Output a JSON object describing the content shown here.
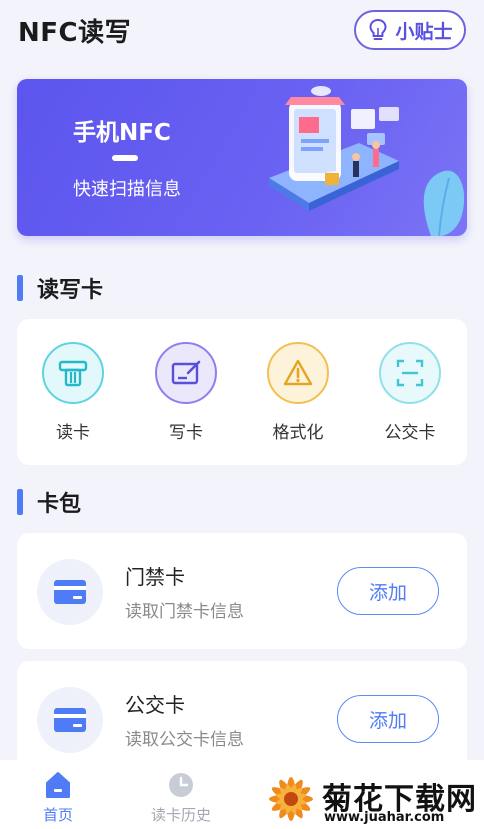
{
  "header": {
    "title": "NFC读写",
    "tips_label": "小贴士"
  },
  "banner": {
    "title": "手机NFC",
    "subtitle": "快速扫描信息"
  },
  "read_write": {
    "section_title": "读写卡",
    "items": [
      {
        "label": "读卡",
        "icon": "card-reader-icon",
        "color": "#3fc6d6"
      },
      {
        "label": "写卡",
        "icon": "edit-card-icon",
        "color": "#7567e8"
      },
      {
        "label": "格式化",
        "icon": "warning-icon",
        "color": "#f0b33a"
      },
      {
        "label": "公交卡",
        "icon": "scan-icon",
        "color": "#3fc6d6"
      }
    ]
  },
  "wallet": {
    "section_title": "卡包",
    "cards": [
      {
        "name": "门禁卡",
        "description": "读取门禁卡信息",
        "button": "添加"
      },
      {
        "name": "公交卡",
        "description": "读取公交卡信息",
        "button": "添加"
      }
    ]
  },
  "bottom_nav": {
    "items": [
      {
        "label": "首页",
        "icon": "home-icon",
        "active": true
      },
      {
        "label": "读卡历史",
        "icon": "clock-icon",
        "active": false
      }
    ]
  },
  "watermark": {
    "title": "菊花下载网",
    "url": "www.juahar.com"
  },
  "colors": {
    "accent": "#5c55ee",
    "blue": "#4f7cf6",
    "background": "#f3f4fb"
  }
}
